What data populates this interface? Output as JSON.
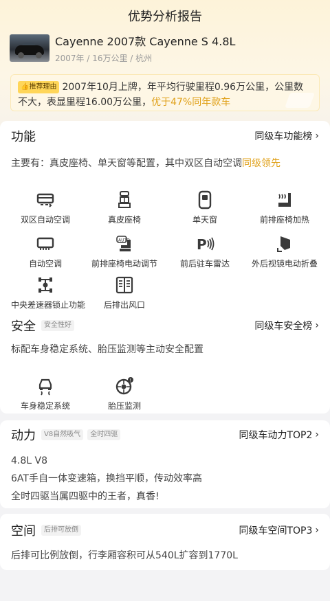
{
  "page_title": "优势分析报告",
  "car": {
    "name": "Cayenne 2007款 Cayenne S 4.8L",
    "meta": "2007年 / 16万公里 / 杭州"
  },
  "reason": {
    "badge": "推荐理由",
    "text": "2007年10月上牌，年平均行驶里程0.96万公里，公里数不大，表显里程16.00万公里，",
    "highlight": "优于47%同年款车"
  },
  "function": {
    "title": "功能",
    "rank": "同级车功能榜",
    "desc_prefix": "主要有：真皮座椅、单天窗等配置，其中双区自动空调",
    "desc_highlight": "同级领先",
    "items": [
      {
        "label": "双区自动空调",
        "icon": "dual-zone-ac-icon"
      },
      {
        "label": "真皮座椅",
        "icon": "leather-seat-icon"
      },
      {
        "label": "单天窗",
        "icon": "sunroof-icon"
      },
      {
        "label": "前排座椅加热",
        "icon": "seat-heating-icon"
      },
      {
        "label": "自动空调",
        "icon": "auto-ac-icon"
      },
      {
        "label": "前排座椅电动调节",
        "icon": "power-seat-icon"
      },
      {
        "label": "前后驻车雷达",
        "icon": "parking-radar-icon"
      },
      {
        "label": "外后视镜电动折叠",
        "icon": "mirror-fold-icon"
      },
      {
        "label": "中央差速器锁止功能",
        "icon": "diff-lock-icon"
      },
      {
        "label": "后排出风口",
        "icon": "rear-vent-icon"
      }
    ]
  },
  "safety": {
    "title": "安全",
    "tag": "安全性好",
    "rank": "同级车安全榜",
    "desc": "标配车身稳定系统、胎压监测等主动安全配置",
    "items": [
      {
        "label": "车身稳定系统",
        "icon": "stability-control-icon"
      },
      {
        "label": "胎压监测",
        "icon": "tire-pressure-icon"
      }
    ]
  },
  "power": {
    "title": "动力",
    "tags": [
      "V8自然吸气",
      "全时四驱"
    ],
    "rank": "同级车动力TOP2",
    "lines": [
      "4.8L V8",
      "6AT手自一体变速箱，换挡平顺，传动效率高",
      "全时四驱当属四驱中的王者，真香!"
    ]
  },
  "space": {
    "title": "空间",
    "tag": "后排可放倒",
    "rank": "同级车空间TOP3",
    "desc": "后排可比例放倒，行李厢容积可从540L扩容到1770L"
  }
}
